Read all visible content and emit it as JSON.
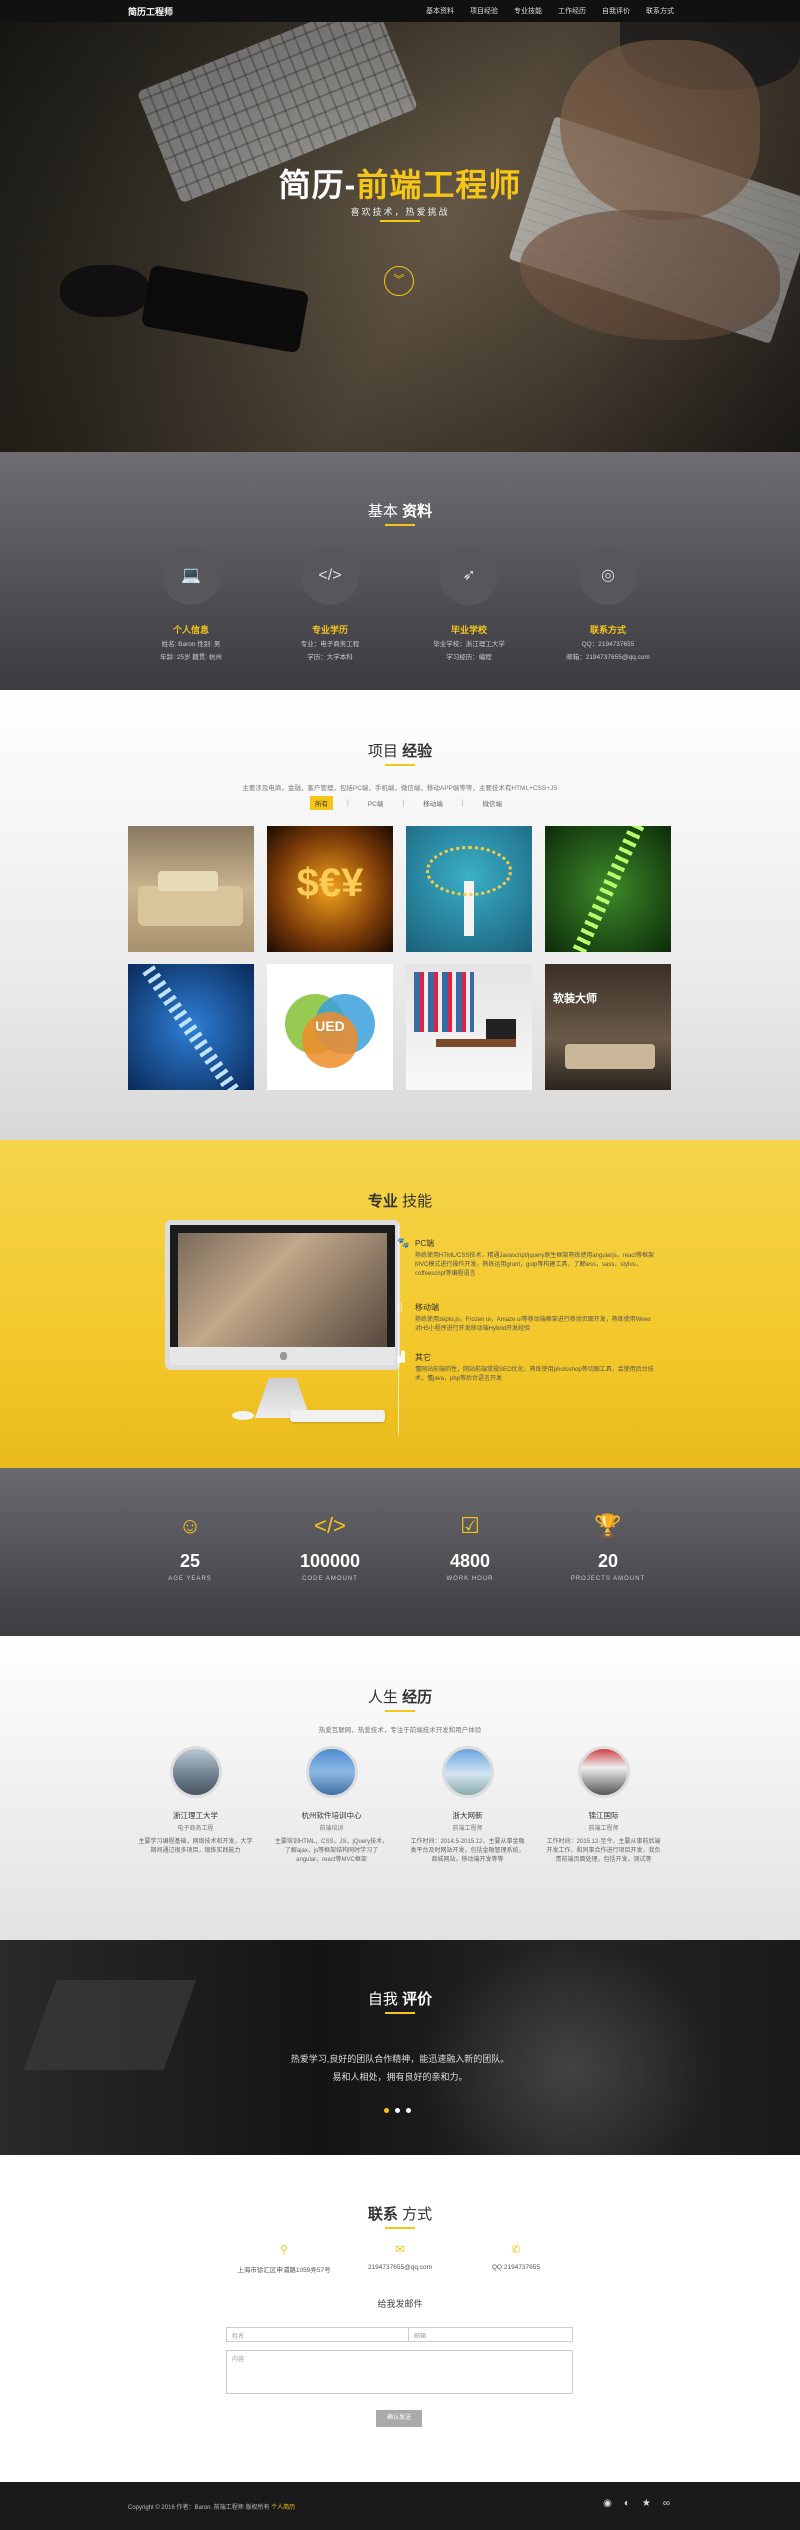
{
  "nav": {
    "logo_prefix": "",
    "logo": "简历工程师",
    "items": [
      "基本资料",
      "项目经验",
      "专业技能",
      "工作经历",
      "自我评价",
      "联系方式"
    ]
  },
  "hero": {
    "title_a": "简历-",
    "title_b": "前端工程师",
    "subtitle": "喜欢技术，热爱挑战",
    "down_icon": "chevron-double-down-icon"
  },
  "basic": {
    "title_a": "基本",
    "title_b": "资料",
    "items": [
      {
        "icon": "laptop-icon",
        "title": "个人信息",
        "d1": "姓名: Baron 性别: 男",
        "d2": "年龄: 25岁 籍贯: 杭州"
      },
      {
        "icon": "code-icon",
        "title": "专业学历",
        "d1": "专业：电子商务工程",
        "d2": "学历：大学本科"
      },
      {
        "icon": "rocket-icon",
        "title": "毕业学校",
        "d1": "毕业学校：浙江理工大学",
        "d2": "学习经历：编程"
      },
      {
        "icon": "target-icon",
        "title": "联系方式",
        "d1": "QQ：2194737655",
        "d2": "邮箱：2194737655@qq.com"
      }
    ]
  },
  "projects": {
    "title_a": "项目",
    "title_b": "经验",
    "desc": "主要涉及电商，金融，客户管理，包括PC端，手机端，微信端，移动APP端等等，主要技术有HTML+CSS+JS",
    "tabs": [
      "所有",
      "PC端",
      "移动端",
      "微信端"
    ],
    "thumb_names": [
      "project-living-room",
      "project-finance-symbols",
      "project-tech-tree",
      "project-dna-green",
      "project-dna-blue",
      "project-ued-logo",
      "project-office-desk",
      "project-lounge"
    ],
    "ued_text": "UED",
    "lounge_text": "软装大师"
  },
  "skills": {
    "title_a": "专业",
    "title_b": "技能",
    "items": [
      {
        "icon": "cat-icon",
        "title": "PC端",
        "desc": "熟练使用HTML/CSS技术，精通Javascript/jquery原生框架熟练使用angularjs，react等框架MVC模式进行操作开发，熟练运用grunt，gulp等构建工具，了解less，sass，stylus，coffeescript等编程语言"
      },
      {
        "icon": "mobile-icon",
        "title": "移动端",
        "desc": "熟练使用zepto.js，Frozen ui，Amaze ui等移动端框架进行移动页面开发，熟练使用Weex对H5小程序进行开发移动端Hybrid开发经验"
      },
      {
        "icon": "chart-icon",
        "title": "其它",
        "desc": "懂网站前端的性，网站前端常规SEO优化，熟练使用photoshop等切图工具，会使用后台技术，懂java，php等后台语言开发"
      }
    ]
  },
  "stats": [
    {
      "icon": "smile-icon",
      "value": "25",
      "label": "AGE YEARS"
    },
    {
      "icon": "code-icon",
      "value": "100000",
      "label": "CODE AMOUNT"
    },
    {
      "icon": "check-icon",
      "value": "4800",
      "label": "WORK HOUR"
    },
    {
      "icon": "trophy-icon",
      "value": "20",
      "label": "PROJECTS AMOUNT"
    }
  ],
  "life": {
    "title_a": "人生",
    "title_b": "经历",
    "desc": "热爱互联网，热爱技术，专注于前端技术开发和用户体验",
    "items": [
      {
        "title": "浙江理工大学",
        "sub": "电子商务工程",
        "desc": "主要学习编程基础，网络技术和开发，大学期间通过很多项目，锻炼实践能力"
      },
      {
        "title": "杭州软件培训中心",
        "sub": "前端培训",
        "desc": "主要培训HTML，CSS，JS，jQuery技术，了解ajax，js等框架结构同时学习了angular，react等MVC框架"
      },
      {
        "title": "浙大网新",
        "sub": "前端工程师",
        "desc": "工作时间：2014.5-2015.12，主要从事金融类平台及时网站开发，包括金融管理系统，商城网站，移动端开发等等"
      },
      {
        "title": "锦江国际",
        "sub": "前端工程师",
        "desc": "工作时间：2015.12-至今，主要从事前后端开发工作，和同事合作进行项目开发，我负责前端页面处理，包括开发，测试等"
      }
    ]
  },
  "eval": {
    "title_a": "自我",
    "title_b": "评价",
    "line1": "热爱学习,良好的团队合作精神，能迅速融入新的团队。",
    "line2": "易和人相处，拥有良好的亲和力。"
  },
  "contact": {
    "title_a": "联系",
    "title_b": "方式",
    "items": [
      {
        "icon": "location-icon",
        "text": "上海市徐汇区申浦路1059弄57号"
      },
      {
        "icon": "mail-icon",
        "text": "2194737655@qq.com"
      },
      {
        "icon": "phone-icon",
        "text": "QQ:2194737655"
      }
    ],
    "mail_title": "给我发邮件",
    "name_placeholder": "姓名",
    "email_placeholder": "邮箱",
    "content_placeholder": "内容",
    "send_label": "确认发送"
  },
  "footer": {
    "copyright": "Copyright © 2016 作者：Baron. 前端工程师 版权所有 ",
    "link": "个人简历"
  }
}
